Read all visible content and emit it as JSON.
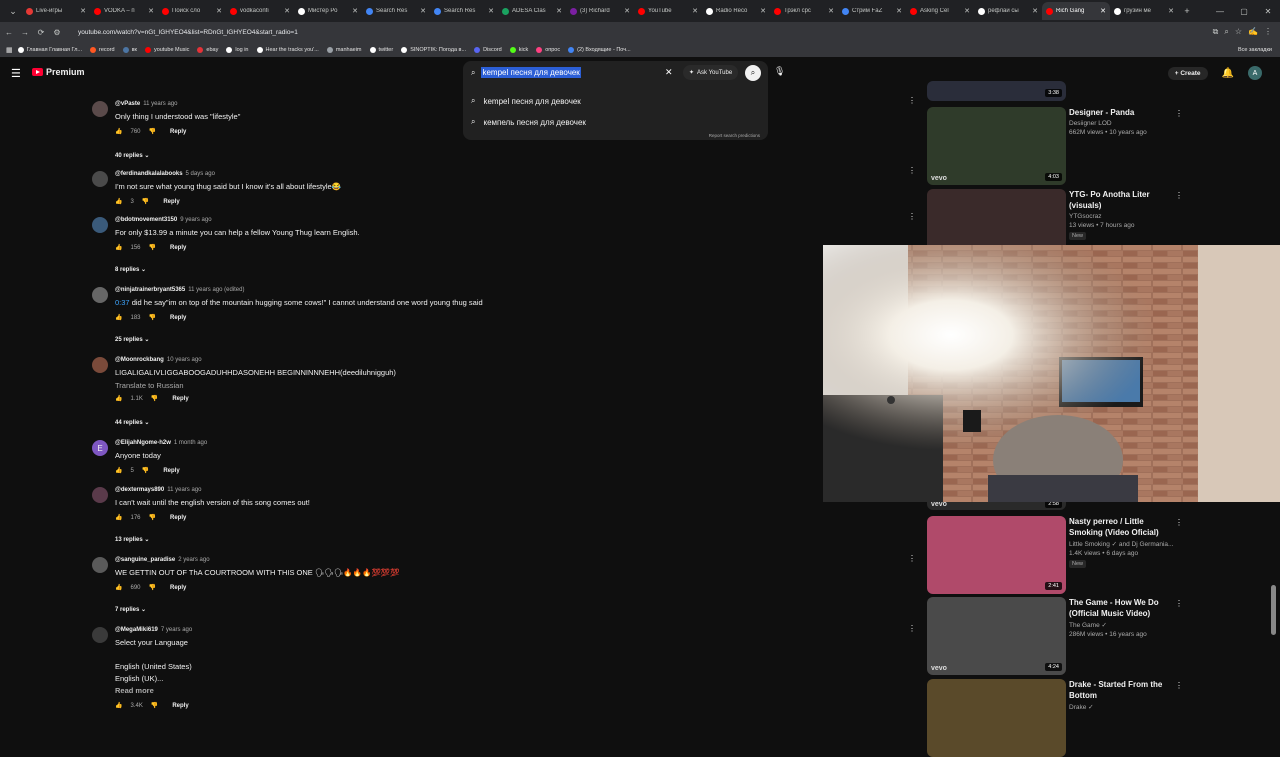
{
  "browser": {
    "tabs": [
      {
        "title": "Live-игры",
        "color": "#e53935"
      },
      {
        "title": "VODKA – п",
        "color": "#ff0000"
      },
      {
        "title": "Поиск сло",
        "color": "#ff0000"
      },
      {
        "title": "vodkaconfi",
        "color": "#ff0000"
      },
      {
        "title": "Мистер Ро",
        "color": "#ffffff"
      },
      {
        "title": "Search Res",
        "color": "#4285f4"
      },
      {
        "title": "Search Res",
        "color": "#4285f4"
      },
      {
        "title": "ADESA Clas",
        "color": "#1aa260"
      },
      {
        "title": "(3) Richard",
        "color": "#7b1fa2"
      },
      {
        "title": "YouTube",
        "color": "#ff0000"
      },
      {
        "title": "Radio Reco",
        "color": "#ffffff"
      },
      {
        "title": "Трэкл срс",
        "color": "#ff0000"
      },
      {
        "title": "Стрим FaZ",
        "color": "#4285f4"
      },
      {
        "title": "Asking Cel",
        "color": "#ff0000"
      },
      {
        "title": "рефлай сы",
        "color": "#ffffff"
      },
      {
        "title": "Rich Gang",
        "color": "#ff0000",
        "active": true
      },
      {
        "title": "грузин ме",
        "color": "#ffffff"
      }
    ],
    "url": "youtube.com/watch?v=nGt_lGHYEO4&list=RDnGt_lGHYEO4&start_radio=1",
    "bookmarks": [
      "Главная Главная Гл...",
      "record",
      "вк",
      "youtube Music",
      "ebay",
      "log in",
      "Hear the tracks you'...",
      "manhaeim",
      "twitter",
      "SINOPTIK: Погода в...",
      "Discord",
      "kick",
      "опрос",
      "(2) Входящие - Поч..."
    ],
    "all_bookmarks": "Все закладки"
  },
  "youtube": {
    "logo_text": "Premium",
    "search": {
      "query": "kempel песня для девочек",
      "ask_label": "Ask YouTube",
      "suggestions": [
        "kempel песня для девочек",
        "кемпель песня для девочек"
      ],
      "report": "Report search predictions"
    },
    "create_label": "Create"
  },
  "comments": [
    {
      "author": "@vPaste",
      "ago": "11 years ago",
      "text": "Only thing I understood was \"lifestyle\"",
      "likes": "760",
      "replies": "40 replies",
      "avatar_color": "#5a4a4a"
    },
    {
      "author": "@ferdinandkalalabooks",
      "ago": "5 days ago",
      "text": "I'm not sure what young thug said but I know it's all about lifestyle😂",
      "likes": "3",
      "replies": "",
      "avatar_color": "#4a4a4a"
    },
    {
      "author": "@bdotmovement3150",
      "ago": "9 years ago",
      "text": "For only $13.99 a minute you can help a fellow Young Thug learn English.",
      "likes": "156",
      "replies": "8 replies",
      "avatar_color": "#3a5a7a"
    },
    {
      "author": "@ninjatrainerbryant5365",
      "ago": "11 years ago (edited)",
      "timestamp": "0:37",
      "text": " did he say\"im on top of the mountain hugging some cows!\" I cannot understand one word young thug said",
      "likes": "183",
      "replies": "25 replies",
      "avatar_color": "#666666"
    },
    {
      "author": "@Moonrockbang",
      "ago": "10 years ago",
      "text": "LIGALIGALIVLIGGABOOGADUHHDASONEHH BEGINNINNNEHH(deediluhnigguh)",
      "translate": "Translate to Russian",
      "likes": "1.1K",
      "replies": "44 replies",
      "avatar_color": "#7a4a3a"
    },
    {
      "author": "@ElijahNgome-h2w",
      "ago": "1 month ago",
      "text": "Anyone today",
      "likes": "5",
      "replies": "",
      "avatar_color": "#7e57c2",
      "initial": "E"
    },
    {
      "author": "@dextermays890",
      "ago": "11 years ago",
      "text": "I can't wait until the english version of this song comes out!",
      "likes": "176",
      "replies": "13 replies",
      "avatar_color": "#5a3a4a"
    },
    {
      "author": "@sanguine_paradise",
      "ago": "2 years ago",
      "text": "WE GETTIN OUT OF ThA COURTROOM WITH THIS ONE 🗣🗣🗣🔥🔥🔥💯💯💯",
      "likes": "690",
      "replies": "7 replies",
      "avatar_color": "#5a5a5a"
    },
    {
      "author": "@MegaMiki619",
      "ago": "7 years ago",
      "lines": [
        "Select your Language",
        "",
        "English (United States)",
        "English (UK)..."
      ],
      "read_more": "Read more",
      "likes": "3.4K",
      "replies": "",
      "avatar_color": "#3a3a3a"
    }
  ],
  "reply_label": "Reply",
  "recommendations": [
    {
      "title": "",
      "channel": "",
      "meta": "",
      "duration": "3:38",
      "thumb": "#2a2d3a",
      "partial": true
    },
    {
      "title": "Designer - Panda",
      "channel": "Desiigner LOD",
      "meta": "662M views • 10 years ago",
      "duration": "4:03",
      "thumb": "#2f3b2a",
      "vevo": "vevo"
    },
    {
      "title": "YTG- Po Anotha Liter (visuals)",
      "channel": "YTGsocraz",
      "meta": "13 views • 7 hours ago",
      "badge": "New",
      "duration": "",
      "thumb": "#3a2a2a"
    },
    {
      "title": "Nasty perreo / Little Smoking (Video Oficial)",
      "channel": "Little Smoking ✓ and Dj Germania...",
      "meta": "1.4K views • 6 days ago",
      "badge": "New",
      "duration": "2:41",
      "thumb": "#b04a6a"
    },
    {
      "title": "The Game - How We Do (Official Music Video)",
      "channel": "The Game ✓",
      "meta": "286M views • 16 years ago",
      "duration": "4:24",
      "thumb": "#4a4a4a",
      "vevo": "vevo"
    },
    {
      "title": "Drake - Started From the Bottom",
      "channel": "Drake ✓",
      "meta": "",
      "duration": "",
      "thumb": "#5a4a2a"
    }
  ],
  "partial_duration": "2:58"
}
